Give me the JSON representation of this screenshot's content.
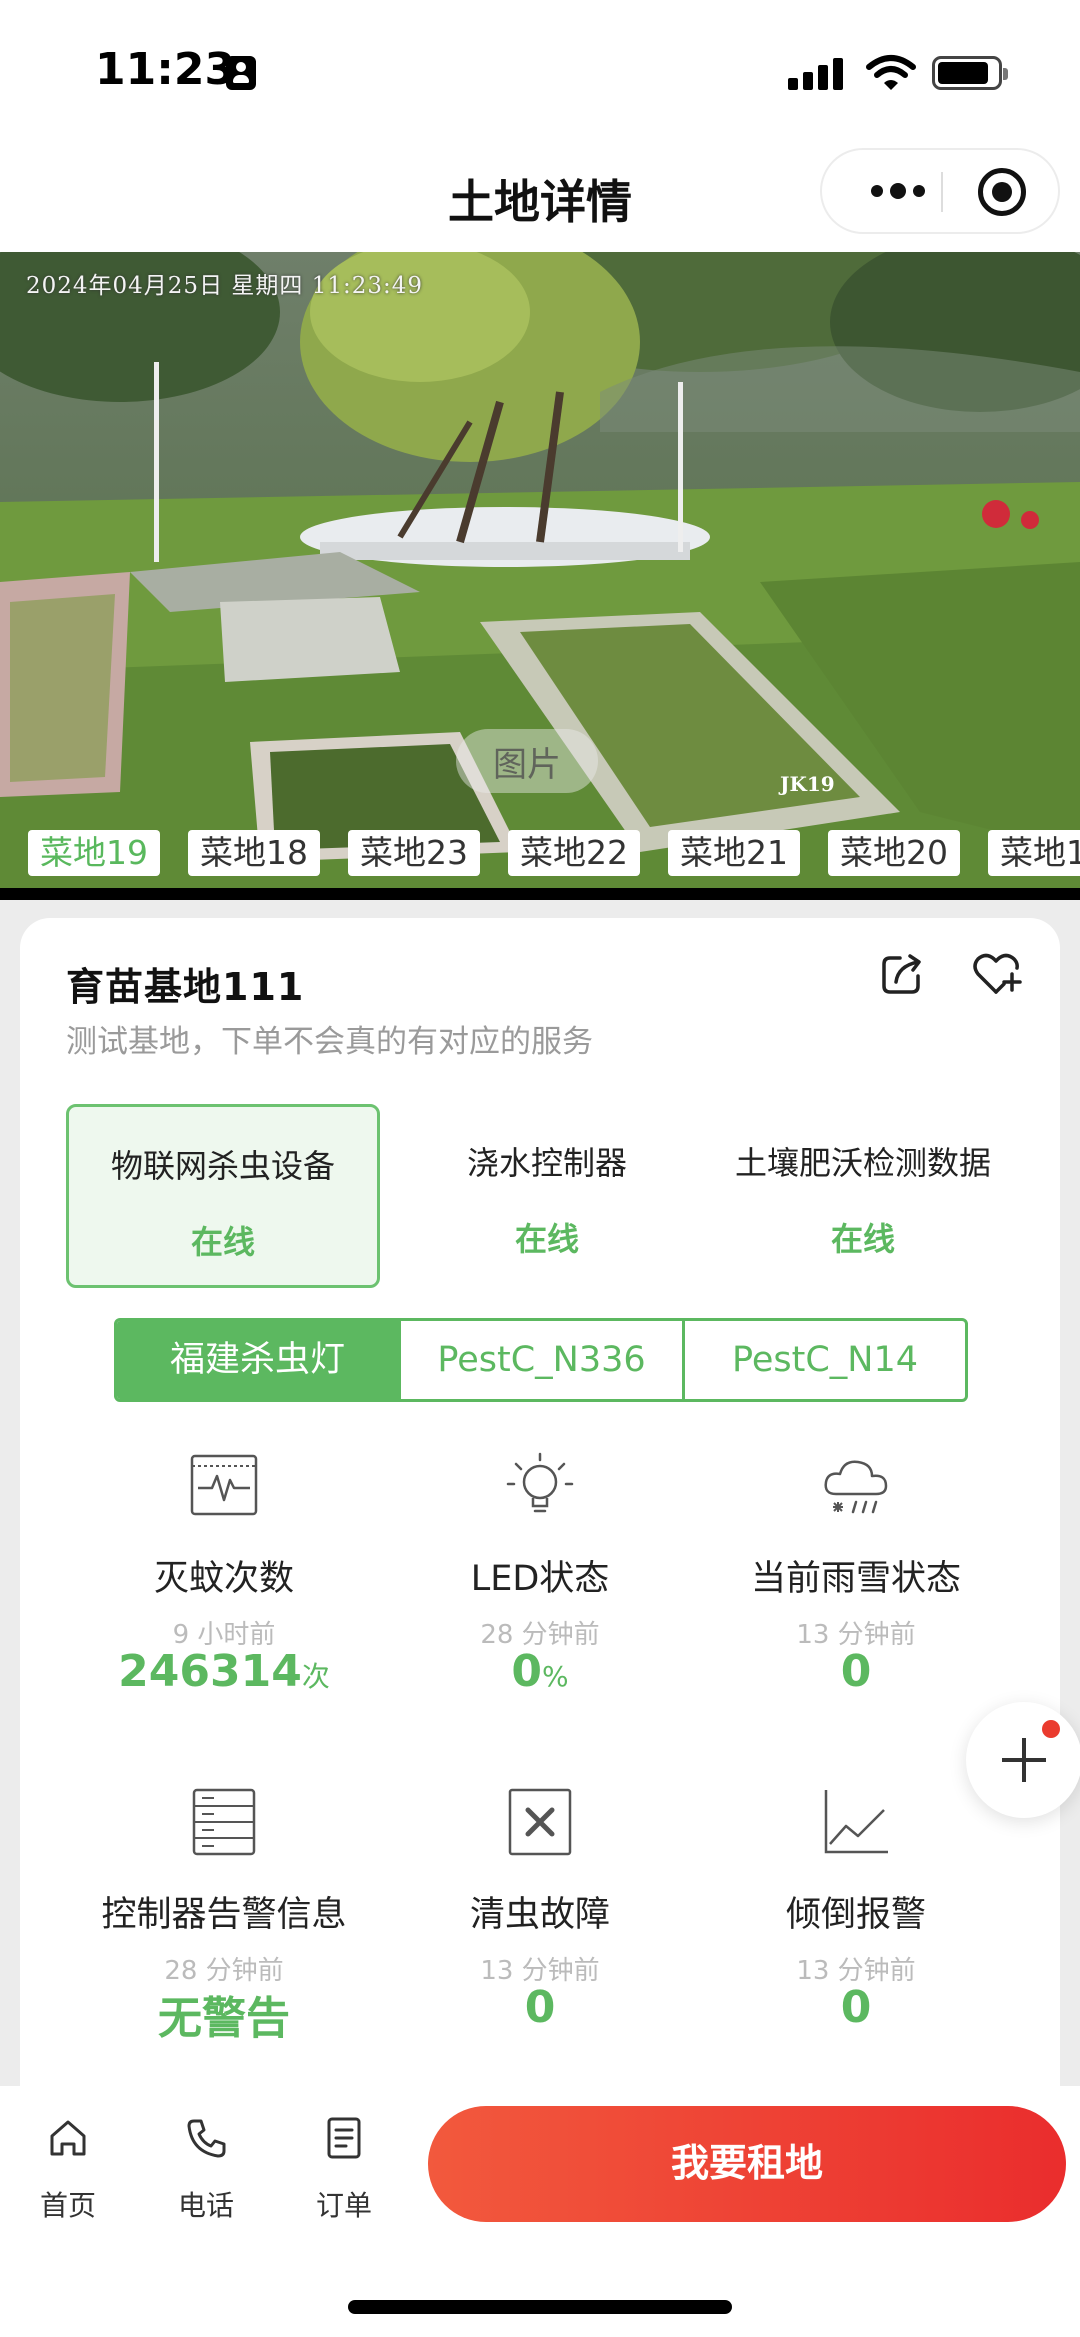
{
  "status_bar": {
    "time": "11:23"
  },
  "nav": {
    "title": "土地详情"
  },
  "camera": {
    "timestamp": "2024年04月25日 星期四 11:23:49",
    "watermark": "图片",
    "camera_label": "JK19",
    "plot_tabs": [
      {
        "label": "菜地19",
        "active": true
      },
      {
        "label": "菜地18",
        "active": false
      },
      {
        "label": "菜地23",
        "active": false
      },
      {
        "label": "菜地22",
        "active": false
      },
      {
        "label": "菜地21",
        "active": false
      },
      {
        "label": "菜地20",
        "active": false
      },
      {
        "label": "菜地1",
        "active": false
      }
    ]
  },
  "base": {
    "name": "育苗基地111",
    "description": "测试基地，下单不会真的有对应的服务"
  },
  "devices": [
    {
      "name": "物联网杀虫设备",
      "status": "在线",
      "active": true
    },
    {
      "name": "浇水控制器",
      "status": "在线",
      "active": false
    },
    {
      "name": "土壤肥沃检测数据",
      "status": "在线",
      "active": false
    }
  ],
  "sub_devices": [
    {
      "label": "福建杀虫灯",
      "active": true
    },
    {
      "label": "PestC_N336",
      "active": false
    },
    {
      "label": "PestC_N14",
      "active": false
    }
  ],
  "metrics": [
    {
      "name": "灭蚊次数",
      "time": "9 小时前",
      "value": "246314",
      "unit": "次",
      "icon": "pulse-monitor-icon"
    },
    {
      "name": "LED状态",
      "time": "28 分钟前",
      "value": "0",
      "unit": "%",
      "icon": "lightbulb-icon"
    },
    {
      "name": "当前雨雪状态",
      "time": "13 分钟前",
      "value": "0",
      "unit": "",
      "icon": "rain-snow-cloud-icon"
    },
    {
      "name": "控制器告警信息",
      "time": "28 分钟前",
      "value": "无警告",
      "unit": "",
      "icon": "server-list-icon"
    },
    {
      "name": "清虫故障",
      "time": "13 分钟前",
      "value": "0",
      "unit": "",
      "icon": "close-box-icon"
    },
    {
      "name": "倾倒报警",
      "time": "13 分钟前",
      "value": "0",
      "unit": "",
      "icon": "line-chart-icon"
    }
  ],
  "bottom_bar": {
    "tabs": [
      {
        "label": "首页",
        "icon": "home-icon"
      },
      {
        "label": "电话",
        "icon": "phone-icon"
      },
      {
        "label": "订单",
        "icon": "order-icon"
      }
    ],
    "rent_button": "我要租地"
  },
  "colors": {
    "accent_green": "#5cb860",
    "rent_gradient_start": "#f2593d",
    "rent_gradient_end": "#ea2d2d",
    "badge_red": "#ea3b2e"
  }
}
